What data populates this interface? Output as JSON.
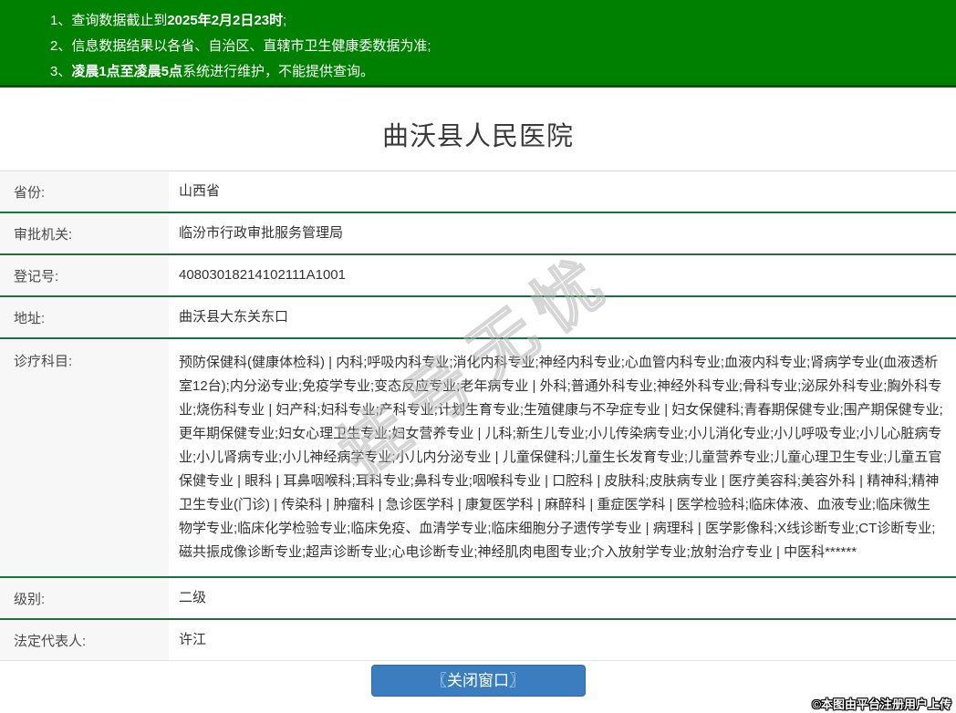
{
  "colors": {
    "banner_green": "#008000",
    "row_divider_green": "#1d6f41",
    "button_blue": "#3a7ebf"
  },
  "notice": {
    "line1": {
      "pre": "1、查询数据截止到",
      "bold": "2025年2月2日23时",
      "post": ";"
    },
    "line2": {
      "pre": "2、信息数据结果以各省、自治区、直辖市卫生健康委数据为准;",
      "bold": "",
      "post": ""
    },
    "line3": {
      "pre": "3、",
      "bold": "凌晨1点至凌晨5点",
      "post": "系统进行维护，不能提供查询。"
    }
  },
  "page": {
    "title": "曲沃县人民医院"
  },
  "fields": [
    {
      "label": "省份:",
      "value": "山西省"
    },
    {
      "label": "审批机关:",
      "value": "临汾市行政审批服务管理局"
    },
    {
      "label": "登记号:",
      "value": "40803018214102111A1001"
    },
    {
      "label": "地址:",
      "value": "曲沃县大东关东口"
    },
    {
      "label": "诊疗科目:",
      "value": "预防保健科(健康体检科) | 内科;呼吸内科专业;消化内科专业;神经内科专业;心血管内科专业;血液内科专业;肾病学专业(血液透析室12台);内分泌专业;免疫学专业;变态反应专业;老年病专业 | 外科;普通外科专业;神经外科专业;骨科专业;泌尿外科专业;胸外科专业;烧伤科专业 | 妇产科;妇科专业;产科专业;计划生育专业;生殖健康与不孕症专业 | 妇女保健科;青春期保健专业;围产期保健专业;更年期保健专业;妇女心理卫生专业;妇女营养专业 | 儿科;新生儿专业;小儿传染病专业;小儿消化专业;小儿呼吸专业;小儿心脏病专业;小儿肾病专业;小儿神经病学专业;小儿内分泌专业 | 儿童保健科;儿童生长发育专业;儿童营养专业;儿童心理卫生专业;儿童五官保健专业 | 眼科 | 耳鼻咽喉科;耳科专业;鼻科专业;咽喉科专业 | 口腔科 | 皮肤科;皮肤病专业 | 医疗美容科;美容外科 | 精神科;精神卫生专业(门诊) | 传染科 | 肿瘤科 | 急诊医学科 | 康复医学科 | 麻醉科 | 重症医学科 | 医学检验科;临床体液、血液专业;临床微生物学专业;临床化学检验专业;临床免疫、血清学专业;临床细胞分子遗传学专业 | 病理科 | 医学影像科;X线诊断专业;CT诊断专业;磁共振成像诊断专业;超声诊断专业;心电诊断专业;神经肌肉电图专业;介入放射学专业;放射治疗专业 | 中医科******"
    },
    {
      "label": "级别:",
      "value": "二级"
    },
    {
      "label": "法定代表人:",
      "value": "许江"
    }
  ],
  "button": {
    "close_label": "〖关闭窗口〗"
  },
  "watermark": {
    "diagonal": "挂号无忧",
    "footer": "©本图由平台注册用户上传"
  }
}
